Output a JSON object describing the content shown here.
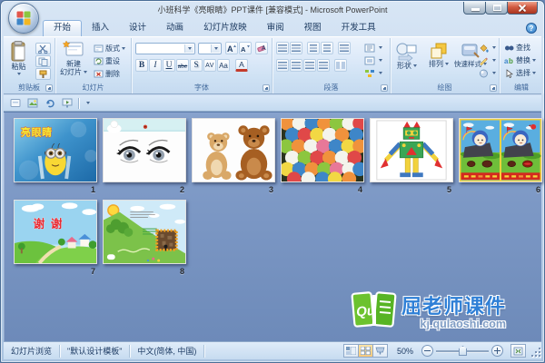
{
  "window": {
    "title": "小班科学《亮眼睛》PPT课件 [兼容模式] - Microsoft PowerPoint"
  },
  "icons": {
    "help": "?"
  },
  "tabs": [
    {
      "label": "开始"
    },
    {
      "label": "插入"
    },
    {
      "label": "设计"
    },
    {
      "label": "动画"
    },
    {
      "label": "幻灯片放映"
    },
    {
      "label": "审阅"
    },
    {
      "label": "视图"
    },
    {
      "label": "开发工具"
    }
  ],
  "ribbon": {
    "clipboard": {
      "group_label": "剪贴板",
      "paste_label": "粘贴"
    },
    "slides_group": {
      "group_label": "幻灯片",
      "new_slide_line1": "新建",
      "new_slide_line2": "幻灯片",
      "layout_label": "版式",
      "reset_label": "重设",
      "delete_label": "删除"
    },
    "font": {
      "group_label": "字体",
      "bold": "B",
      "italic": "I",
      "underline": "U",
      "strikethrough": "abe",
      "shadow": "S",
      "char_spacing": "AV",
      "change_case": "Aa",
      "font_color": "A"
    },
    "paragraph": {
      "group_label": "段落"
    },
    "drawing": {
      "group_label": "绘图",
      "shapes_label": "形状",
      "arrange_label": "排列",
      "quick_styles_label": "快速样式"
    },
    "editing": {
      "group_label": "编辑",
      "find_label": "查找",
      "replace_label": "替换",
      "select_label": "选择"
    }
  },
  "slides": [
    {
      "num": "1",
      "caption": "亮眼睛"
    },
    {
      "num": "2"
    },
    {
      "num": "3"
    },
    {
      "num": "4"
    },
    {
      "num": "5"
    },
    {
      "num": "6"
    },
    {
      "num": "7",
      "caption": "谢 谢"
    },
    {
      "num": "8"
    }
  ],
  "watermark": {
    "logo_text": "Qu",
    "brand": "屈老师课件",
    "url": "kj.qulaoshi.com"
  },
  "status_bar": {
    "view_mode": "幻灯片浏览",
    "template_name": "\"默认设计模板\"",
    "language": "中文(简体, 中国)",
    "zoom_level": "50%"
  },
  "colors": {
    "accent_blue": "#2e7fd6",
    "close_red": "#c74a32",
    "sorter_top": "#87a2cd",
    "sorter_bottom": "#6d8ab9"
  }
}
